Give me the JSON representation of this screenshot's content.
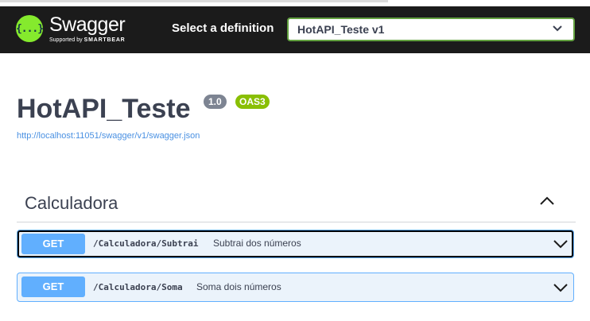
{
  "header": {
    "logo_mark": "{...}",
    "brand": "Swagger",
    "supported_by": "Supported by",
    "supported_by_company": "SMARTBEAR",
    "select_label": "Select a definition",
    "selected_definition": "HotAPI_Teste v1"
  },
  "info": {
    "title": "HotAPI_Teste",
    "version": "1.0",
    "spec_badge": "OAS3",
    "spec_url": "http://localhost:11051/swagger/v1/swagger.json"
  },
  "tag": {
    "name": "Calculadora",
    "expanded": true
  },
  "operations": [
    {
      "method": "GET",
      "path": "/Calculadora/Subtrai",
      "summary": "Subtrai dos números"
    },
    {
      "method": "GET",
      "path": "/Calculadora/Soma",
      "summary": "Soma dois números"
    }
  ],
  "colors": {
    "topbar": "#1b1b1b",
    "brand_green": "#85ea2d",
    "get_blue": "#61affe",
    "get_bg": "#ebf3fb",
    "text": "#3b4151",
    "link": "#4990e2"
  },
  "icons": {
    "logo": "swagger-logo-icon",
    "dropdown": "chevron-down-icon",
    "collapse": "chevron-up-icon",
    "expand_op": "chevron-down-icon"
  }
}
